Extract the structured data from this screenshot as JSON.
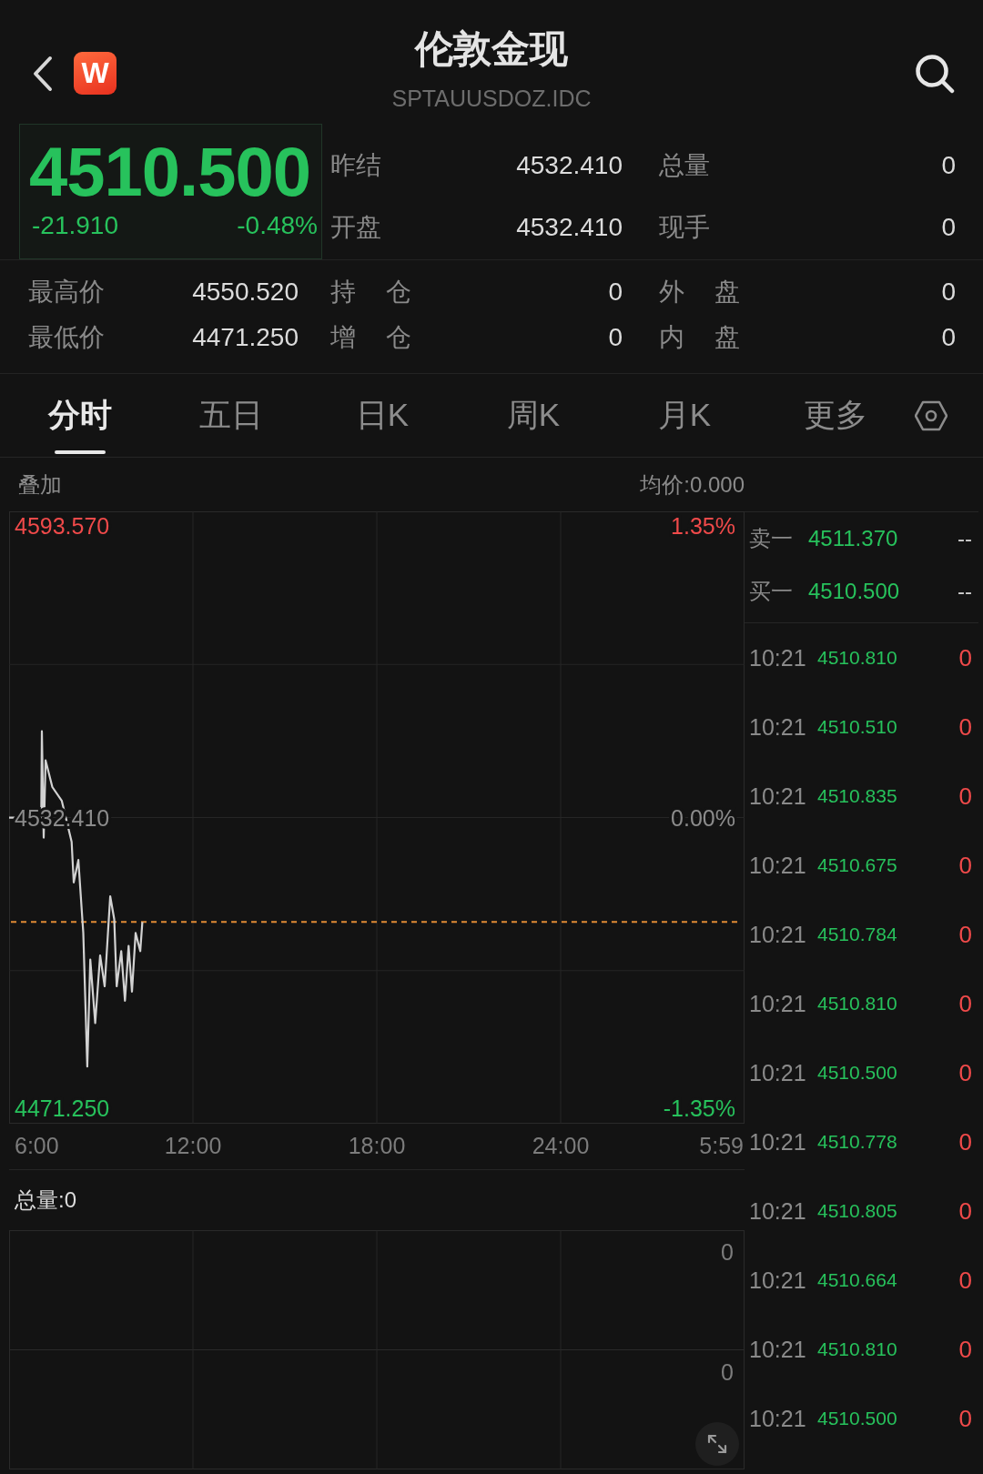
{
  "header": {
    "title": "伦敦金现",
    "subtitle": "SPTAUUSDOZ.IDC",
    "logo_letter": "W"
  },
  "quote": {
    "price": "4510.500",
    "change": "-21.910",
    "change_percent": "-0.48%",
    "falling": true
  },
  "summary_stats": [
    {
      "label": "昨结",
      "value": "4532.410"
    },
    {
      "label": "总量",
      "value": "0"
    },
    {
      "label": "开盘",
      "value": "4532.410"
    },
    {
      "label": "现手",
      "value": "0"
    }
  ],
  "detail_stats": [
    {
      "label": "最高价",
      "value": "4550.520"
    },
    {
      "label": "持 仓",
      "value": "0"
    },
    {
      "label": "外 盘",
      "value": "0"
    },
    {
      "label": "最低价",
      "value": "4471.250"
    },
    {
      "label": "增 仓",
      "value": "0"
    },
    {
      "label": "内 盘",
      "value": "0"
    }
  ],
  "tabs": [
    {
      "label": "分时",
      "selected": true
    },
    {
      "label": "五日",
      "selected": false
    },
    {
      "label": "日K",
      "selected": false
    },
    {
      "label": "周K",
      "selected": false
    },
    {
      "label": "月K",
      "selected": false
    },
    {
      "label": "更多",
      "selected": false
    }
  ],
  "price_chart": {
    "overlay_button": "叠加",
    "average_price": "均价:0.000",
    "right_labels": [
      {
        "text": "1.35%",
        "color": "#f04a4a"
      },
      {
        "text": "0.00%",
        "color": "#8c8c8c"
      },
      {
        "text": "-1.35%",
        "color": "#27c25c"
      }
    ],
    "axis_end_label": "5:59",
    "chart_data": {
      "type": "line",
      "x": [
        6,
        7.05,
        7.07,
        7.13,
        7.19,
        7.41,
        7.72,
        8.04,
        8.11,
        8.26,
        8.42,
        8.55,
        8.65,
        8.81,
        8.97,
        9.12,
        9.3,
        9.43,
        9.51,
        9.66,
        9.78,
        9.9,
        10.01,
        10.13,
        10.28,
        10.35
      ],
      "series": [
        {
          "color": "#d2d2d2",
          "values": [
            4532.4,
            4532.4,
            4550.5,
            4528.2,
            4544.4,
            4538.8,
            4535.9,
            4527.3,
            4518.8,
            4523.5,
            4508.2,
            4480.2,
            4502.6,
            4489.3,
            4503.5,
            4497.0,
            4515.9,
            4511.1,
            4497.0,
            4504.4,
            4494.0,
            4505.5,
            4495.9,
            4508.2,
            4504.4,
            4510.5
          ]
        }
      ],
      "xlim": [
        6,
        30
      ],
      "ylim": [
        4468.19,
        4596.63
      ],
      "xticks": [
        {
          "value": 6,
          "label": "6:00"
        },
        {
          "value": 12,
          "label": "12:00"
        },
        {
          "value": 18,
          "label": "18:00"
        },
        {
          "value": 24,
          "label": "24:00"
        }
      ],
      "yticks": [
        {
          "value": 4593.57,
          "label": "4593.570"
        },
        {
          "value": 4532.41,
          "label": "4532.410"
        },
        {
          "value": 4471.25,
          "label": "4471.250"
        }
      ],
      "grid": true,
      "ref_lines": [
        {
          "axis": "y",
          "value": 4510.5,
          "color": "#e08a34"
        }
      ]
    }
  },
  "volume_chart": {
    "title": "总量:0",
    "axis_labels": [
      "0",
      "0"
    ]
  },
  "order_book": [
    {
      "label": "卖一",
      "price": "4511.370",
      "volume": "--"
    },
    {
      "label": "买一",
      "price": "4510.500",
      "volume": "--"
    }
  ],
  "trades": [
    {
      "time": "10:21",
      "price": "4510.810",
      "volume": "0"
    },
    {
      "time": "10:21",
      "price": "4510.510",
      "volume": "0"
    },
    {
      "time": "10:21",
      "price": "4510.835",
      "volume": "0"
    },
    {
      "time": "10:21",
      "price": "4510.675",
      "volume": "0"
    },
    {
      "time": "10:21",
      "price": "4510.784",
      "volume": "0"
    },
    {
      "time": "10:21",
      "price": "4510.810",
      "volume": "0"
    },
    {
      "time": "10:21",
      "price": "4510.500",
      "volume": "0"
    },
    {
      "time": "10:21",
      "price": "4510.778",
      "volume": "0"
    },
    {
      "time": "10:21",
      "price": "4510.805",
      "volume": "0"
    },
    {
      "time": "10:21",
      "price": "4510.664",
      "volume": "0"
    },
    {
      "time": "10:21",
      "price": "4510.810",
      "volume": "0"
    },
    {
      "time": "10:21",
      "price": "4510.500",
      "volume": "0"
    }
  ]
}
